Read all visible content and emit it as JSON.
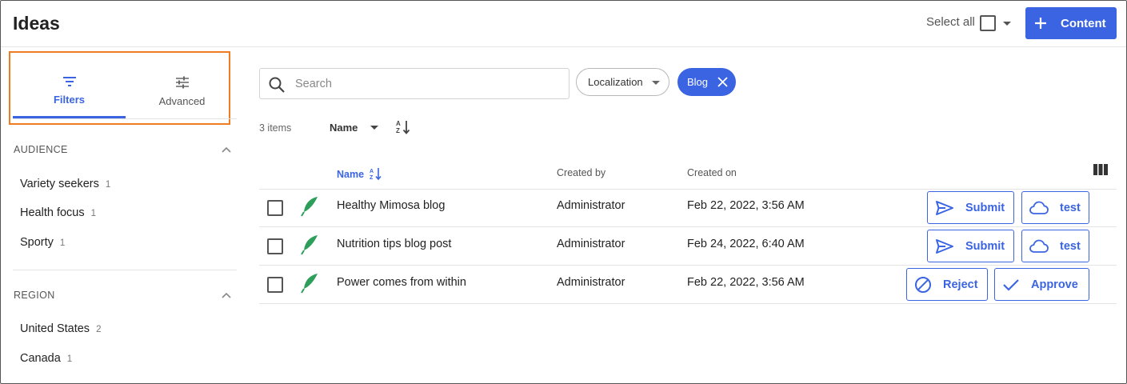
{
  "header": {
    "title": "Ideas",
    "select_all_label": "Select all",
    "content_button_label": "Content"
  },
  "sidebar": {
    "tabs": [
      {
        "label": "Filters",
        "icon": "filter-icon",
        "active": true
      },
      {
        "label": "Advanced",
        "icon": "sliders-icon",
        "active": false
      }
    ],
    "sections": [
      {
        "title": "AUDIENCE",
        "expanded": true,
        "items": [
          {
            "label": "Variety seekers",
            "count": "1"
          },
          {
            "label": "Health focus",
            "count": "1"
          },
          {
            "label": "Sporty",
            "count": "1"
          }
        ]
      },
      {
        "title": "REGION",
        "expanded": true,
        "items": [
          {
            "label": "United States",
            "count": "2"
          },
          {
            "label": "Canada",
            "count": "1"
          }
        ]
      }
    ]
  },
  "toolbar": {
    "search_placeholder": "Search",
    "search_value": "",
    "localization_label": "Localization",
    "active_filter_chip": "Blog",
    "items_count": "3 items",
    "sort_label": "Name"
  },
  "table": {
    "columns": [
      "Name",
      "Created by",
      "Created on"
    ],
    "rows": [
      {
        "name": "Healthy Mimosa blog",
        "created_by": "Administrator",
        "created_on": "Feb 22, 2022, 3:56 AM",
        "actions": [
          {
            "label": "Submit",
            "icon": "send-icon"
          },
          {
            "label": "test",
            "icon": "cloud-icon"
          }
        ]
      },
      {
        "name": "Nutrition tips blog post",
        "created_by": "Administrator",
        "created_on": "Feb 24, 2022, 6:40 AM",
        "actions": [
          {
            "label": "Submit",
            "icon": "send-icon"
          },
          {
            "label": "test",
            "icon": "cloud-icon"
          }
        ]
      },
      {
        "name": "Power comes from within",
        "created_by": "Administrator",
        "created_on": "Feb 22, 2022, 3:56 AM",
        "actions": [
          {
            "label": "Reject",
            "icon": "block-icon"
          },
          {
            "label": "Approve",
            "icon": "check-icon"
          }
        ]
      }
    ]
  },
  "colors": {
    "accent": "#3b64e3",
    "highlight_border": "#f07c21",
    "item_icon": "#2e9e5b",
    "divider": "#e4e4e4"
  }
}
